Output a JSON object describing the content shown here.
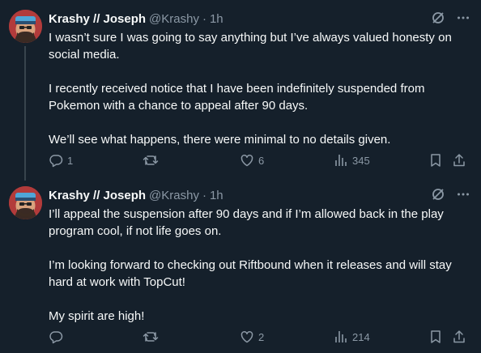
{
  "colors": {
    "background": "#15202b",
    "text": "#f7f9f9",
    "muted": "#8b98a5",
    "thread_line": "#38444d"
  },
  "tweets": [
    {
      "name": "Krashy // Joseph",
      "handle": "@Krashy",
      "separator": "·",
      "time": "1h",
      "paragraphs": [
        "I wasn’t sure I was going to say anything but I’ve always valued honesty on social media.",
        "I recently received notice that I have been indefinitely suspended from Pokemon with a chance to appeal after 90 days.",
        "We’ll see what happens, there were minimal to no details given."
      ],
      "replies": "1",
      "retweets": "",
      "likes": "6",
      "views": "345",
      "icons": [
        "grok-icon",
        "more-icon",
        "reply-icon",
        "retweet-icon",
        "like-icon",
        "views-icon",
        "bookmark-icon",
        "share-icon"
      ]
    },
    {
      "name": "Krashy // Joseph",
      "handle": "@Krashy",
      "separator": "·",
      "time": "1h",
      "paragraphs": [
        "I’ll appeal the suspension after 90 days and if I’m allowed back in the play program cool, if not life goes on.",
        "I’m looking forward to checking out Riftbound when it releases and will stay hard at work with TopCut!",
        "My spirit are high!"
      ],
      "replies": "",
      "retweets": "",
      "likes": "2",
      "views": "214",
      "icons": [
        "grok-icon",
        "more-icon",
        "reply-icon",
        "retweet-icon",
        "like-icon",
        "views-icon",
        "bookmark-icon",
        "share-icon"
      ]
    }
  ]
}
